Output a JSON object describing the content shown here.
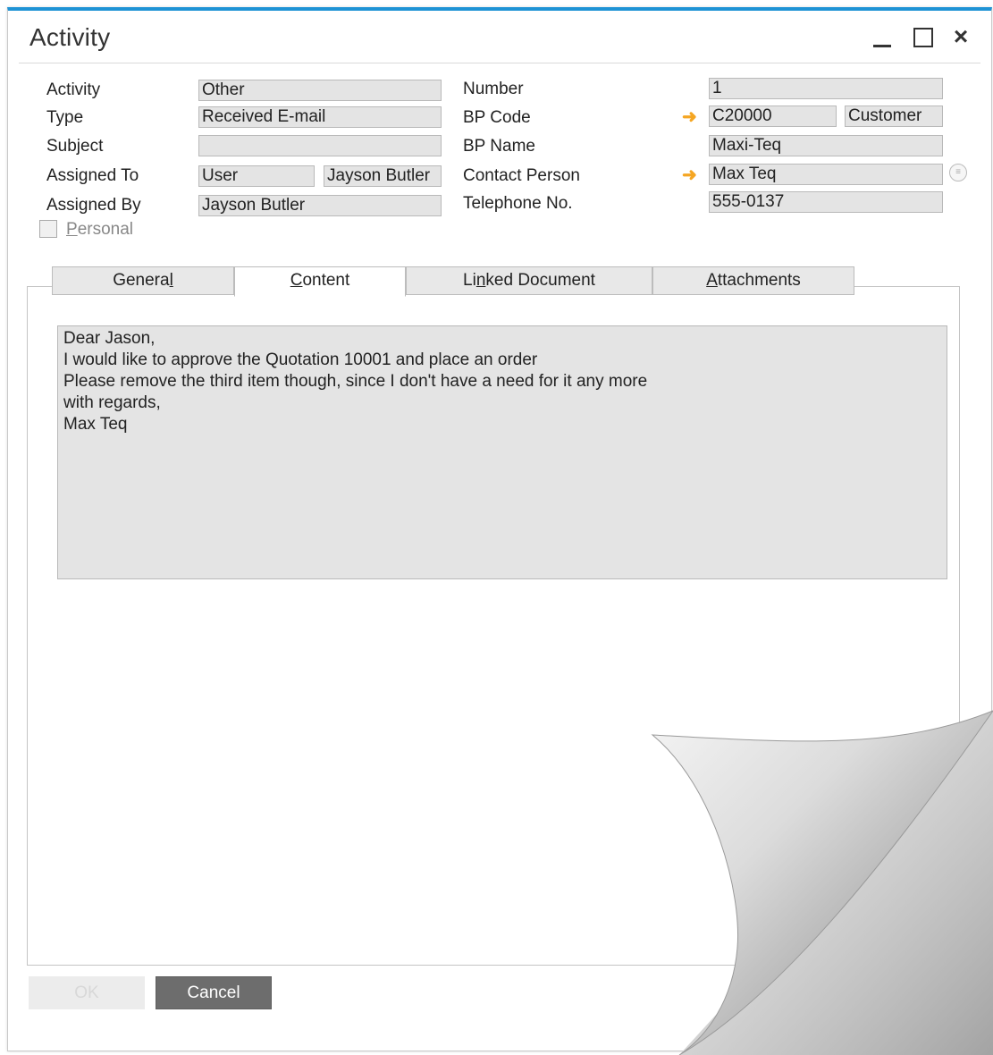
{
  "window": {
    "title": "Activity"
  },
  "form": {
    "left": [
      {
        "label": "Activity",
        "value": "Other"
      },
      {
        "label": "Type",
        "value": "Received E-mail"
      },
      {
        "label": "Subject",
        "value": ""
      },
      {
        "label": "Assigned To",
        "value": "User",
        "value2": "Jayson Butler"
      },
      {
        "label": "Assigned By",
        "value": "Jayson Butler"
      }
    ],
    "right": [
      {
        "label": "Number",
        "value": "1"
      },
      {
        "label": "BP Code",
        "value": "C20000",
        "value2": "Customer"
      },
      {
        "label": "BP Name",
        "value": "Maxi-Teq"
      },
      {
        "label": "Contact Person",
        "value": "Max Teq"
      },
      {
        "label": "Telephone No.",
        "value": "555-0137"
      }
    ],
    "personal": {
      "label_first": "P",
      "label_rest": "ersonal",
      "checked": false
    }
  },
  "tabs": [
    {
      "pre": "Genera",
      "ul": "l",
      "post": ""
    },
    {
      "pre": "",
      "ul": "C",
      "post": "ontent"
    },
    {
      "pre": "Li",
      "ul": "n",
      "post": "ked Document"
    },
    {
      "pre": "",
      "ul": "A",
      "post": "ttachments"
    }
  ],
  "active_tab": "Content",
  "content": {
    "lines": [
      "Dear Jason,",
      "I would like to approve the Quotation 10001 and place an order",
      "Please remove the third item though, since I don't have a need for it any more",
      "with regards,",
      "Max Teq"
    ]
  },
  "buttons": {
    "ok": "OK",
    "cancel": "Cancel"
  },
  "colors": {
    "accent": "#1e93d5",
    "link_arrow": "#f5a623",
    "field_bg": "#e4e4e4"
  }
}
